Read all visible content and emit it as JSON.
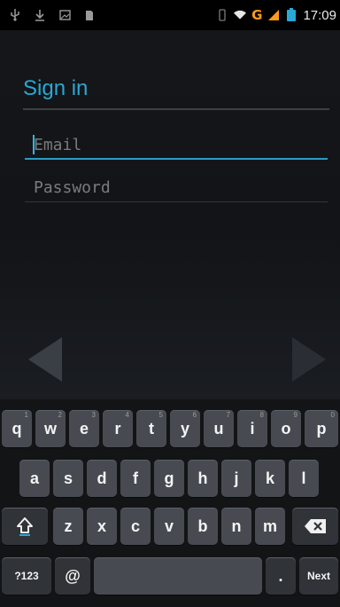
{
  "status_bar": {
    "time": "17:09",
    "network_label": "G",
    "icons": [
      "usb-icon",
      "download-icon",
      "image-icon",
      "sdcard-icon",
      "vibrate-icon",
      "wifi-icon",
      "signal-icon",
      "battery-icon"
    ]
  },
  "signin": {
    "title": "Sign in",
    "email_placeholder": "Email",
    "password_placeholder": "Password"
  },
  "keyboard": {
    "row1": [
      {
        "label": "q",
        "hint": "1"
      },
      {
        "label": "w",
        "hint": "2"
      },
      {
        "label": "e",
        "hint": "3"
      },
      {
        "label": "r",
        "hint": "4"
      },
      {
        "label": "t",
        "hint": "5"
      },
      {
        "label": "y",
        "hint": "6"
      },
      {
        "label": "u",
        "hint": "7"
      },
      {
        "label": "i",
        "hint": "8"
      },
      {
        "label": "o",
        "hint": "9"
      },
      {
        "label": "p",
        "hint": "0"
      }
    ],
    "row2": [
      "a",
      "s",
      "d",
      "f",
      "g",
      "h",
      "j",
      "k",
      "l"
    ],
    "row3": [
      "z",
      "x",
      "c",
      "v",
      "b",
      "n",
      "m"
    ],
    "shift_icon": "shift-icon",
    "delete_icon": "backspace-icon",
    "numeric_label": "?123",
    "at_label": "@",
    "period_label": ".",
    "next_label": "Next"
  },
  "colors": {
    "accent": "#2aa8d6",
    "keyboard_key": "#474b51",
    "background": "#0e0f11"
  }
}
